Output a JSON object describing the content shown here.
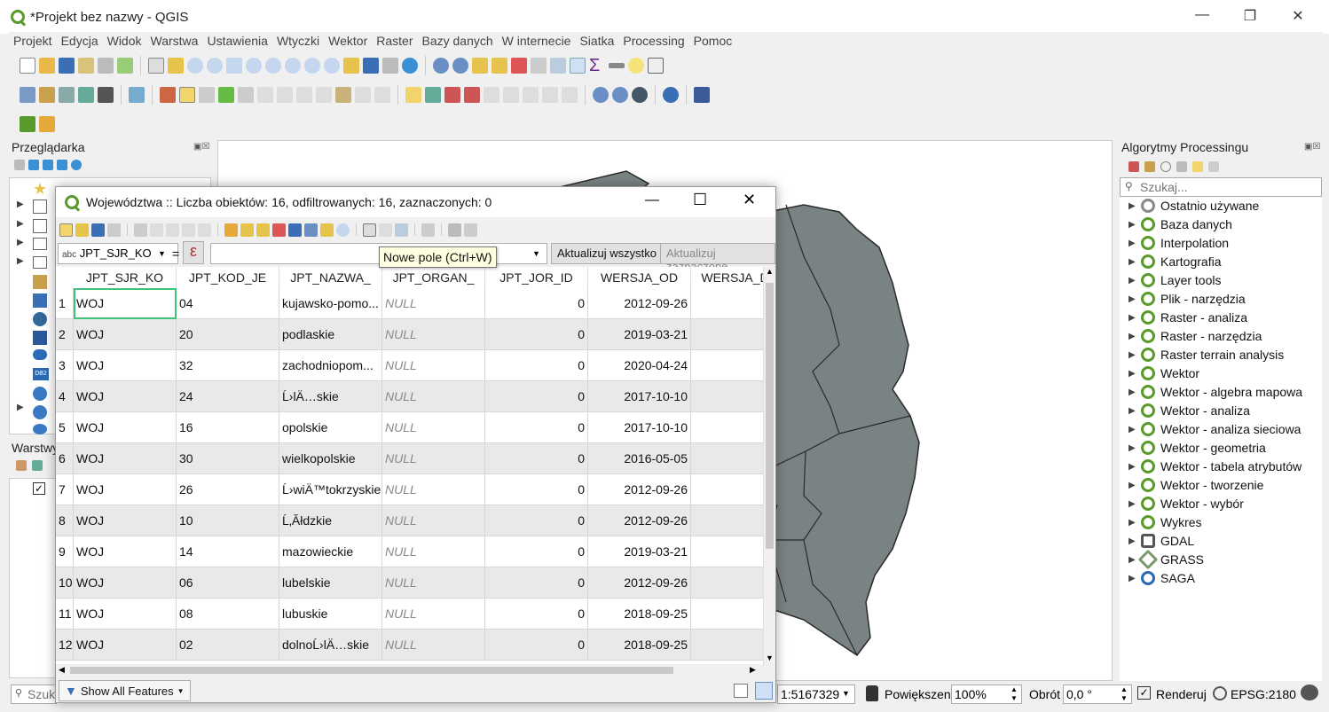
{
  "app": {
    "title": "*Projekt bez nazwy - QGIS"
  },
  "menu": [
    "Projekt",
    "Edycja",
    "Widok",
    "Warstwa",
    "Ustawienia",
    "Wtyczki",
    "Wektor",
    "Raster",
    "Bazy danych",
    "W internecie",
    "Siatka",
    "Processing",
    "Pomoc"
  ],
  "browser": {
    "title": "Przeglądarka",
    "layers_title": "Warstwy"
  },
  "processing": {
    "title": "Algorytmy Processingu",
    "search_placeholder": "Szukaj...",
    "items": [
      "Ostatnio używane",
      "Baza danych",
      "Interpolation",
      "Kartografia",
      "Layer tools",
      "Plik - narzędzia",
      "Raster - analiza",
      "Raster - narzędzia",
      "Raster terrain analysis",
      "Wektor",
      "Wektor - algebra mapowa",
      "Wektor - analiza",
      "Wektor - analiza sieciowa",
      "Wektor - geometria",
      "Wektor - tabela atrybutów",
      "Wektor - tworzenie",
      "Wektor - wybór",
      "Wykres",
      "GDAL",
      "GRASS",
      "SAGA"
    ]
  },
  "dialog": {
    "title": "Województwa :: Liczba obiektów: 16, odfiltrowanych: 16, zaznaczonych: 0",
    "field_select": "JPT_SJR_KO",
    "field_prefix": "abc",
    "equals": "=",
    "epsilon": "ε",
    "update_all": "Aktualizuj wszystko",
    "update_selected": "Aktualizuj zaznaczone",
    "tooltip": "Nowe pole (Ctrl+W)",
    "show_features": "Show All Features",
    "columns": [
      "JPT_SJR_KO",
      "JPT_KOD_JE",
      "JPT_NAZWA_",
      "JPT_ORGAN_",
      "JPT_JOR_ID",
      "WERSJA_OD",
      "WERSJA_D"
    ],
    "rows": [
      [
        "1",
        "WOJ",
        "04",
        "kujawsko-pomo...",
        "NULL",
        "0",
        "2012-09-26"
      ],
      [
        "2",
        "WOJ",
        "20",
        "podlaskie",
        "NULL",
        "0",
        "2019-03-21"
      ],
      [
        "3",
        "WOJ",
        "32",
        "zachodniopom...",
        "NULL",
        "0",
        "2020-04-24"
      ],
      [
        "4",
        "WOJ",
        "24",
        "Ĺ›lÄ…skie",
        "NULL",
        "0",
        "2017-10-10"
      ],
      [
        "5",
        "WOJ",
        "16",
        "opolskie",
        "NULL",
        "0",
        "2017-10-10"
      ],
      [
        "6",
        "WOJ",
        "30",
        "wielkopolskie",
        "NULL",
        "0",
        "2016-05-05"
      ],
      [
        "7",
        "WOJ",
        "26",
        "Ĺ›wiÄ™tokrzyskie",
        "NULL",
        "0",
        "2012-09-26"
      ],
      [
        "8",
        "WOJ",
        "10",
        "Ĺ‚Ăłdzkie",
        "NULL",
        "0",
        "2012-09-26"
      ],
      [
        "9",
        "WOJ",
        "14",
        "mazowieckie",
        "NULL",
        "0",
        "2019-03-21"
      ],
      [
        "10",
        "WOJ",
        "06",
        "lubelskie",
        "NULL",
        "0",
        "2012-09-26"
      ],
      [
        "11",
        "WOJ",
        "08",
        "lubuskie",
        "NULL",
        "0",
        "2018-09-25"
      ],
      [
        "12",
        "WOJ",
        "02",
        "dolnoĹ›lÄ…skie",
        "NULL",
        "0",
        "2018-09-25"
      ]
    ]
  },
  "status": {
    "search_placeholder": "Szuk",
    "scale": "1:5167329",
    "zoom_label": "Powiększenie",
    "zoom": "100%",
    "rotation_label": "Obrót",
    "rotation": "0,0 °",
    "render_label": "Renderuj",
    "crs": "EPSG:2180"
  },
  "colors": {
    "map_fill": "#7a8383",
    "accent": "#5a9a2c"
  }
}
